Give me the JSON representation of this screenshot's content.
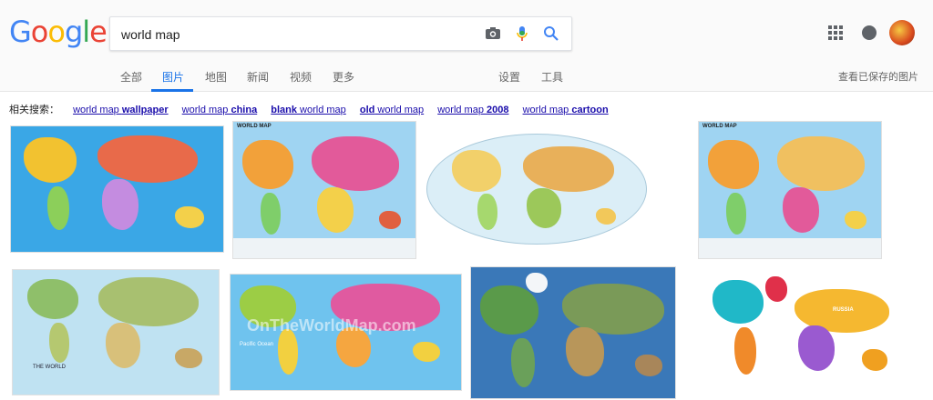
{
  "logo": {
    "letters": [
      "G",
      "o",
      "o",
      "g",
      "l",
      "e"
    ],
    "colors": [
      "#4285F4",
      "#EA4335",
      "#FBBC05",
      "#4285F4",
      "#34A853",
      "#EA4335"
    ]
  },
  "search": {
    "value": "world map",
    "camera_icon": "camera-icon",
    "mic_icon": "mic-icon",
    "search_icon": "search-icon"
  },
  "tabs": {
    "all": "全部",
    "images": "图片",
    "maps": "地图",
    "news": "新闻",
    "videos": "视频",
    "more": "更多",
    "settings": "设置",
    "tools": "工具"
  },
  "saved_images": "查看已保存的图片",
  "related": {
    "prefix": "相关搜索：",
    "items": [
      {
        "plain": "world map ",
        "bold": "wallpaper"
      },
      {
        "plain": "world map ",
        "bold": "china"
      },
      {
        "bold": "blank",
        "plain": " world map"
      },
      {
        "bold": "old",
        "plain": " world map"
      },
      {
        "plain": "world map ",
        "bold": "2008"
      },
      {
        "plain": "world map ",
        "bold": "cartoon"
      }
    ]
  },
  "thumbnails": {
    "t2_label": "WORLD MAP",
    "t4_label": "WORLD MAP",
    "t5_label": "THE WORLD",
    "t6_watermark": "OnTheWorldMap.com",
    "t6_label_ocean": "Pacific Ocean",
    "t8_label": "RUSSIA"
  },
  "colors": {
    "accent": "#1a73e8",
    "link": "#1a0dab",
    "ocean": "#39a5e0"
  }
}
